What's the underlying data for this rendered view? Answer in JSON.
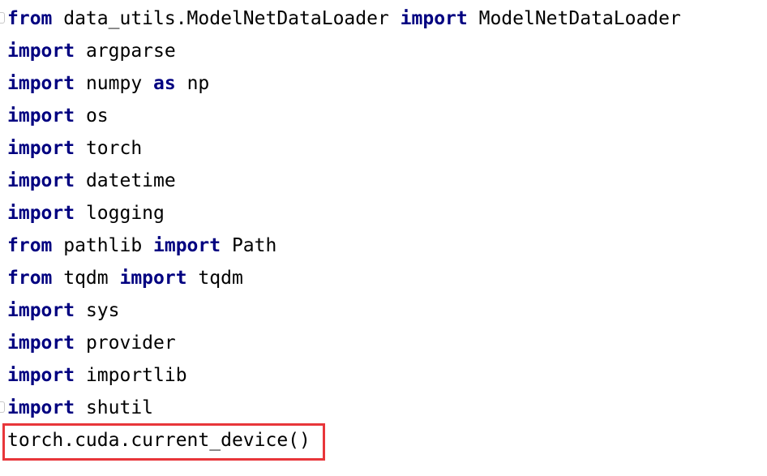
{
  "editor": {
    "lines": [
      {
        "parts": [
          {
            "t": "from",
            "kw": true
          },
          {
            "t": " data_utils.ModelNetDataLoader "
          },
          {
            "t": "import",
            "kw": true
          },
          {
            "t": " ModelNetDataLoader"
          }
        ]
      },
      {
        "parts": [
          {
            "t": "import",
            "kw": true
          },
          {
            "t": " argparse"
          }
        ]
      },
      {
        "parts": [
          {
            "t": "import",
            "kw": true
          },
          {
            "t": " numpy "
          },
          {
            "t": "as",
            "kw": true
          },
          {
            "t": " np"
          }
        ]
      },
      {
        "parts": [
          {
            "t": "import",
            "kw": true
          },
          {
            "t": " os"
          }
        ]
      },
      {
        "parts": [
          {
            "t": "import",
            "kw": true
          },
          {
            "t": " torch"
          }
        ]
      },
      {
        "parts": [
          {
            "t": "import",
            "kw": true
          },
          {
            "t": " datetime"
          }
        ]
      },
      {
        "parts": [
          {
            "t": "import",
            "kw": true
          },
          {
            "t": " logging"
          }
        ]
      },
      {
        "parts": [
          {
            "t": "from",
            "kw": true
          },
          {
            "t": " pathlib "
          },
          {
            "t": "import",
            "kw": true
          },
          {
            "t": " Path"
          }
        ]
      },
      {
        "parts": [
          {
            "t": "from",
            "kw": true
          },
          {
            "t": " tqdm "
          },
          {
            "t": "import",
            "kw": true
          },
          {
            "t": " tqdm"
          }
        ]
      },
      {
        "parts": [
          {
            "t": "import",
            "kw": true
          },
          {
            "t": " sys"
          }
        ]
      },
      {
        "parts": [
          {
            "t": "import",
            "kw": true
          },
          {
            "t": " provider"
          }
        ]
      },
      {
        "parts": [
          {
            "t": "import",
            "kw": true
          },
          {
            "t": " importlib"
          }
        ]
      },
      {
        "parts": [
          {
            "t": "import",
            "kw": true
          },
          {
            "t": " shutil"
          }
        ]
      },
      {
        "parts": [
          {
            "t": "torch.cuda.current_device()"
          }
        ]
      }
    ],
    "highlighted_line": 13,
    "colors": {
      "keyword": "#000080",
      "text": "#000000",
      "highlight_border": "#e8363a",
      "background": "#ffffff"
    }
  }
}
